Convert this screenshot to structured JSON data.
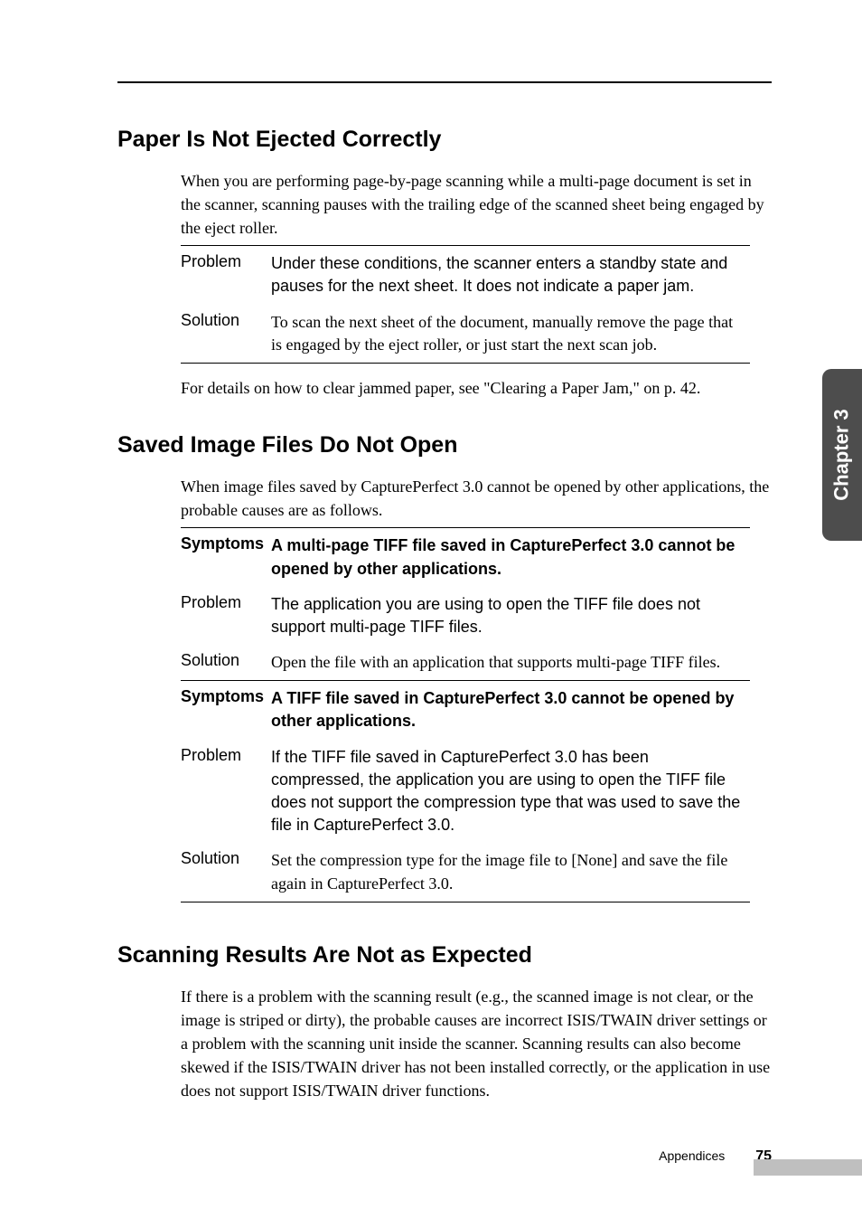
{
  "sidebar": {
    "chapter": "Chapter 3"
  },
  "footer": {
    "label": "Appendices",
    "page": "75"
  },
  "s1": {
    "heading": "Paper Is Not Ejected Correctly",
    "intro": "When you are performing page-by-page scanning while a multi-page document is set in the scanner, scanning pauses with the trailing edge of the scanned sheet being engaged by the eject roller.",
    "rows": [
      {
        "label": "Problem",
        "text": "Under these conditions, the scanner enters a standby state and pauses for the next sheet. It does not indicate a paper jam.",
        "sans": true
      },
      {
        "label": "Solution",
        "text": "To scan the next sheet of the document, manually remove the page that is engaged by the eject roller, or just start the next scan job.",
        "sans": false
      }
    ],
    "outro": "For details on how to clear jammed paper, see \"Clearing a Paper Jam,\" on p. 42."
  },
  "s2": {
    "heading": "Saved Image Files Do Not Open",
    "intro": "When image files saved by CapturePerfect 3.0 cannot be opened by other applications, the probable causes are as follows.",
    "group1": {
      "symLabel": "Symptoms",
      "symText": "A multi-page TIFF file saved in CapturePerfect 3.0 cannot be opened by other applications.",
      "rows": [
        {
          "label": "Problem",
          "text": "The application you are using to open the TIFF file does not support multi-page TIFF files.",
          "sans": true
        },
        {
          "label": "Solution",
          "text": "Open the file with an application that supports multi-page TIFF files.",
          "sans": false
        }
      ]
    },
    "group2": {
      "symLabel": "Symptoms",
      "symText": "A TIFF file saved in CapturePerfect 3.0 cannot be opened by other applications.",
      "rows": [
        {
          "label": "Problem",
          "text": "If the TIFF file saved in CapturePerfect 3.0 has been compressed, the application you are using to open the TIFF file does not support the compression type that was used to save the file in CapturePerfect 3.0.",
          "sans": true
        },
        {
          "label": "Solution",
          "text": "Set the compression type for the image file to [None] and save the file again in CapturePerfect 3.0.",
          "sans": false
        }
      ]
    }
  },
  "s3": {
    "heading": "Scanning Results Are Not as Expected",
    "intro": "If there is a problem with the scanning result (e.g., the scanned image is not clear, or the image is striped or dirty), the probable causes are incorrect ISIS/TWAIN driver settings or a problem with the scanning unit inside the scanner. Scanning results can also become skewed if the ISIS/TWAIN driver has not been installed correctly, or the application in use does not support ISIS/TWAIN driver functions."
  }
}
